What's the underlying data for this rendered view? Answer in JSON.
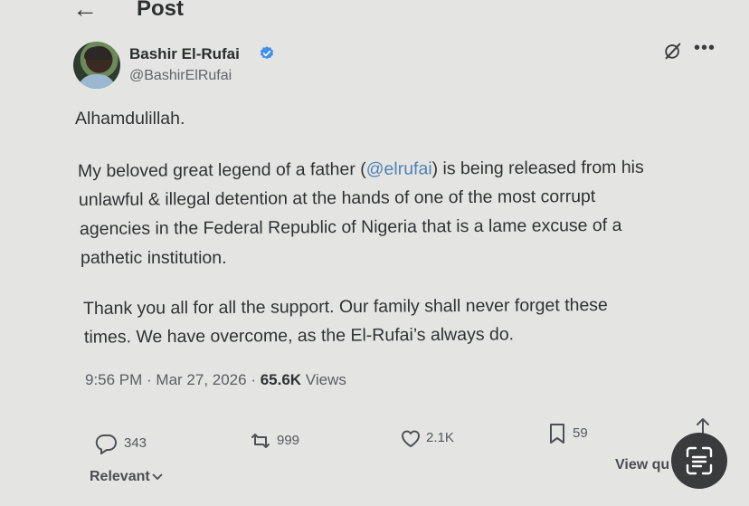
{
  "header": {
    "back_label": "←",
    "title": "Post"
  },
  "author": {
    "name": "Bashir El-Rufai",
    "handle": "@BashirElRufai",
    "verified": true
  },
  "post": {
    "line1": "Alhamdulillah.",
    "p2_line1_before": "My beloved great legend of a father (",
    "p2_mention": "@elrufai",
    "p2_line1_after": ") is being released from his",
    "p2_line2": "unlawful & illegal detention at the hands of one of the most corrupt",
    "p2_line3": "agencies in the Federal Republic of Nigeria that is a lame excuse of a",
    "p2_line4": "pathetic institution.",
    "p3_line1": "Thank you all for all the support. Our family shall never forget these",
    "p3_line2": "times. We have overcome, as the El-Rufai’s always do."
  },
  "meta": {
    "time_date": "9:56 PM · Mar 27, 2026 · ",
    "views_count": "65.6K",
    "views_label": " Views"
  },
  "actions": {
    "replies": "343",
    "reposts": "999",
    "likes": "2.1K",
    "bookmarks": "59"
  },
  "footer": {
    "sort_label": "Relevant",
    "view_quotes_label": "View qu"
  },
  "colors": {
    "background": "#e4e5e3",
    "accent": "#4f82b4",
    "text": "#2f3133"
  },
  "icons": [
    "back-arrow-icon",
    "verified-badge-icon",
    "grok-icon",
    "more-icon",
    "reply-icon",
    "repost-icon",
    "like-icon",
    "bookmark-icon",
    "share-icon",
    "chevron-down-icon",
    "text-scan-icon"
  ]
}
